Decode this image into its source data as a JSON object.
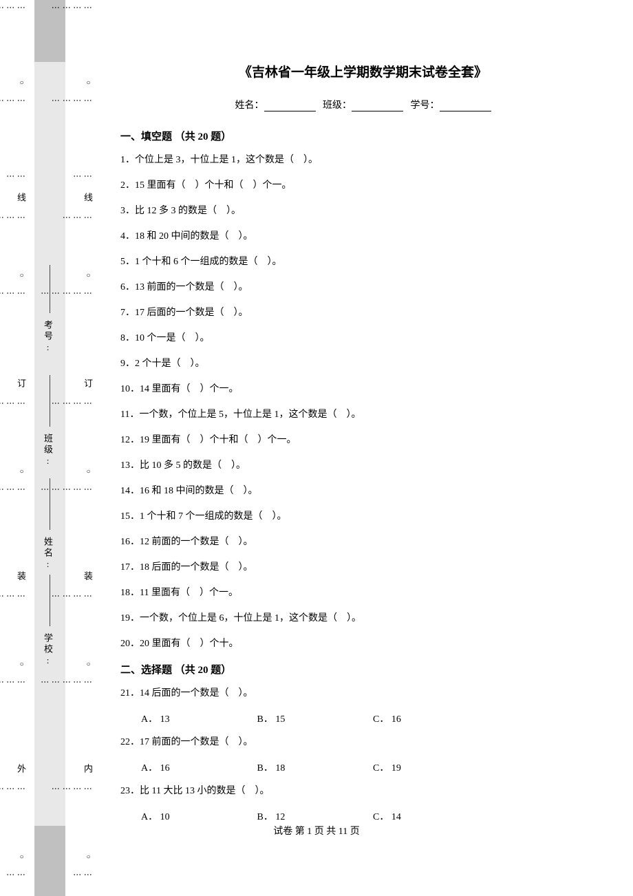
{
  "title": "《吉林省一年级上学期数学期末试卷全套》",
  "meta": {
    "name_label": "姓名：",
    "class_label": "班级：",
    "id_label": "学号："
  },
  "section1": "一、填空题 （共 20 题）",
  "section2": "二、选择题 （共 20 题）",
  "q": {
    "1": "1．个位上是 3，十位上是 1，这个数是（　）。",
    "2": "2．15 里面有（　）个十和（　）个一。",
    "3": "3．比 12 多 3 的数是（　）。",
    "4": "4．18 和 20 中间的数是（　）。",
    "5": "5．1 个十和 6 个一组成的数是（　）。",
    "6": "6．13 前面的一个数是（　）。",
    "7": "7．17 后面的一个数是（　）。",
    "8": "8．10 个一是（　）。",
    "9": "9．2 个十是（　）。",
    "10": "10．14 里面有（　）个一。",
    "11": "11．一个数，个位上是 5，十位上是 1，这个数是（　）。",
    "12": "12．19 里面有（　）个十和（　）个一。",
    "13": "13．比 10 多 5 的数是（　）。",
    "14": "14．16 和 18 中间的数是（　）。",
    "15": "15．1 个十和 7 个一组成的数是（　）。",
    "16": "16．12 前面的一个数是（　）。",
    "17": "17．18 后面的一个数是（　）。",
    "18": "18．11 里面有（　）个一。",
    "19": "19．一个数，个位上是 6，十位上是 1，这个数是（　）。",
    "20": "20．20 里面有（　）个十。",
    "21": "21．14 后面的一个数是（　）。",
    "22": "22．17 前面的一个数是（　）。",
    "23": "23．比 11 大比 13 小的数是（　）。"
  },
  "opts": {
    "21": {
      "a": "A． 13",
      "b": "B． 15",
      "c": "C． 16"
    },
    "22": {
      "a": "A． 16",
      "b": "B． 18",
      "c": "C． 19"
    },
    "23": {
      "a": "A． 10",
      "b": "B． 12",
      "c": "C． 14"
    }
  },
  "footer": "试卷 第 1 页 共 11 页",
  "side": {
    "outer": {
      "wai": "外",
      "zhuang": "装",
      "ding": "订",
      "xian": "线"
    },
    "inner": {
      "nei": "内",
      "zhuang": "装",
      "ding": "订",
      "xian": "线"
    },
    "labels": {
      "school": "学校:",
      "name": "姓名:",
      "class": "班级:",
      "exam": "考号:"
    }
  }
}
